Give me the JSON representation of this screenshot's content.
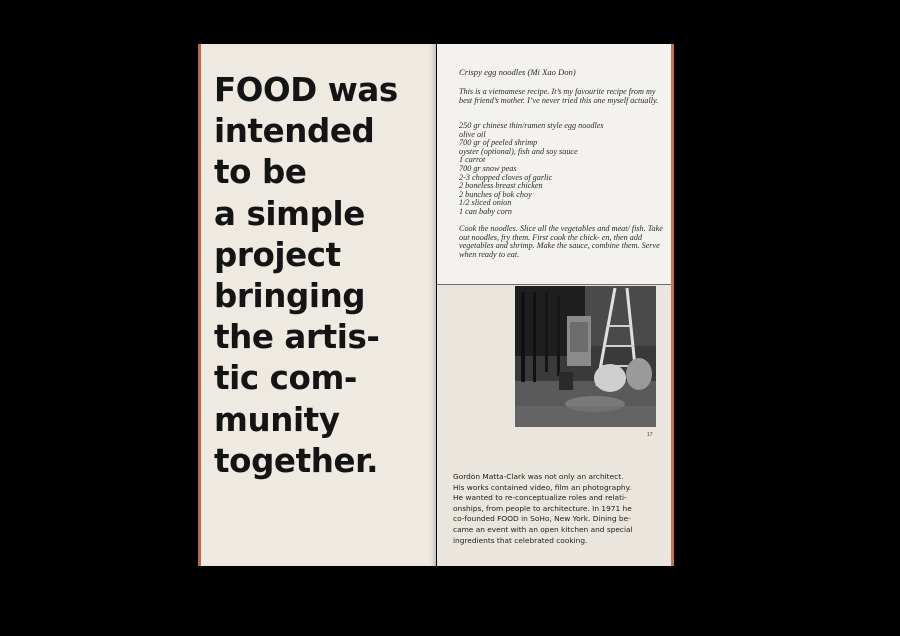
{
  "left_page": {
    "headline_lines": [
      "FOOD was",
      "intended",
      "to be",
      "a simple",
      "project",
      "bringing",
      "the artis-",
      "tic com-",
      "munity",
      "together."
    ]
  },
  "recipe": {
    "title": "Crispy egg noodles (Mi Xao Don)",
    "intro": "This is a vietnamese recipe. It’s my favourite recipe from my best friend’s mother. I’ve never tried this one myself actually.",
    "ingredients": [
      "250 gr chinese thin/ramen style egg noodles",
      "olive oil",
      "700 gr of peeled shrimp",
      "oyster (optional), fish and soy sauce",
      "1 carrot",
      "700 gr snow peas",
      "2-3 chopped cloves of garlic",
      "2 boneless breast chicken",
      "2 bunches of bok choy",
      "1/2 sliced onion",
      "1 can baby corn"
    ],
    "method": "Cook the noodles. Slice all the vegetables and meat/ fish. Take out noodles, fry them. First cook the chick- en, then add vegetables and shrimp. Make the sauce, combine them. Serve when ready to eat."
  },
  "right_page": {
    "page_number": "17",
    "caption_lines": [
      "Gordon Matta-Clark was not only an architect.",
      "His works contained video, film an photography.",
      "He wanted to re-conceptualize roles and relati-",
      "onships, from people to architecture. In 1971 he",
      "co-founded FOOD in SoHo, New York. Dining be-",
      "came an event with an open kitchen and special",
      "ingredients that celebrated cooking."
    ]
  },
  "colors": {
    "background": "#000000",
    "paper_left": "#eeeae1",
    "paper_right": "#eae6dd",
    "recipe_card": "#f3f2ef",
    "edge_accent": "#b96a4a"
  }
}
